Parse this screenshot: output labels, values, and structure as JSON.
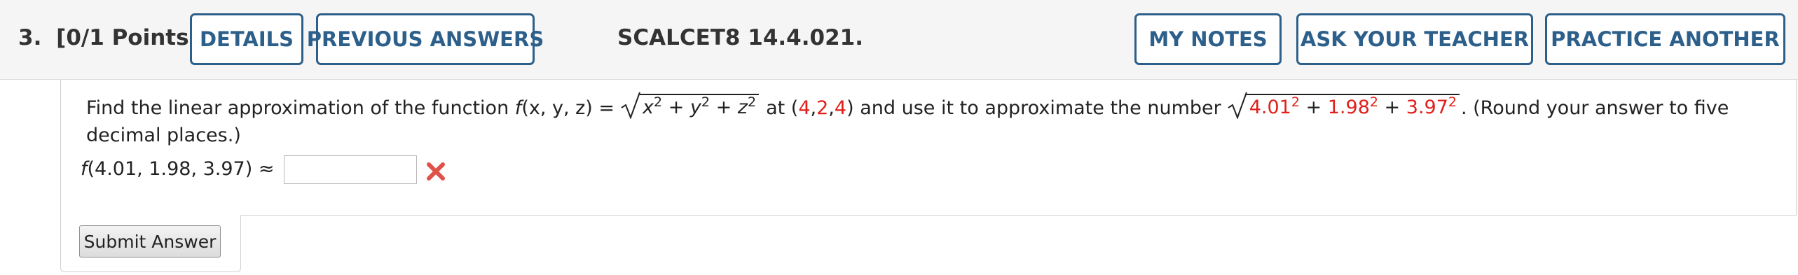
{
  "header": {
    "question_number": "3.",
    "points": "[0/1 Points]",
    "buttons": {
      "details": "DETAILS",
      "previous_answers": "PREVIOUS ANSWERS",
      "my_notes": "MY NOTES",
      "ask_teacher": "ASK YOUR TEACHER",
      "practice_another": "PRACTICE ANOTHER"
    },
    "problem_code": "SCALCET8 14.4.021."
  },
  "question": {
    "intro": "Find the linear approximation of the function",
    "function_name": "f",
    "function_args": "(x, y, z) =",
    "radicand": {
      "x": "x",
      "y": "y",
      "z": "z",
      "exp": "2",
      "plus": " + "
    },
    "at_text": "at (",
    "point": [
      "4",
      "2",
      "4"
    ],
    "sep": ", ",
    "close_paren": ")",
    "mid_text": "and use it to approximate the number",
    "number_terms": [
      "4.01",
      "1.98",
      "3.97"
    ],
    "round_text": ". (Round your answer to five",
    "line2": "decimal places.)",
    "answer_prefix_f": "f",
    "answer_prefix": "(4.01, 1.98, 3.97) ≈"
  },
  "answer": {
    "value": "",
    "status": "incorrect"
  },
  "submit": {
    "label": "Submit Answer"
  },
  "colors": {
    "button_blue": "#2c5f8a",
    "value_red": "#e0201b",
    "wrong_red": "#e0514a"
  }
}
